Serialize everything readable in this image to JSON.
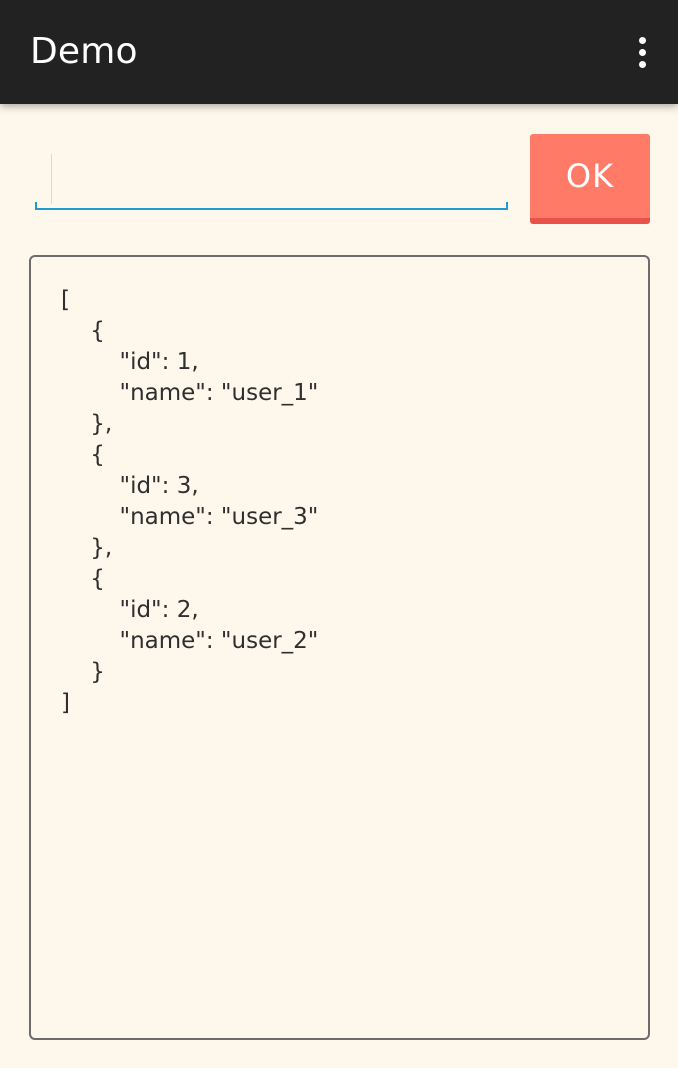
{
  "action_bar": {
    "title": "Demo",
    "overflow_icon": "more-vert-icon",
    "background_color": "#222222"
  },
  "input": {
    "value": "",
    "placeholder": ""
  },
  "ok_button": {
    "label": "OK",
    "color": "#ff7b68"
  },
  "output": {
    "text": "[\n    {\n        \"id\": 1,\n        \"name\": \"user_1\"\n    },\n    {\n        \"id\": 3,\n        \"name\": \"user_3\"\n    },\n    {\n        \"id\": 2,\n        \"name\": \"user_2\"\n    }\n]"
  },
  "colors": {
    "background": "#fdf7ec",
    "accent_underline": "#1f9bd0"
  }
}
